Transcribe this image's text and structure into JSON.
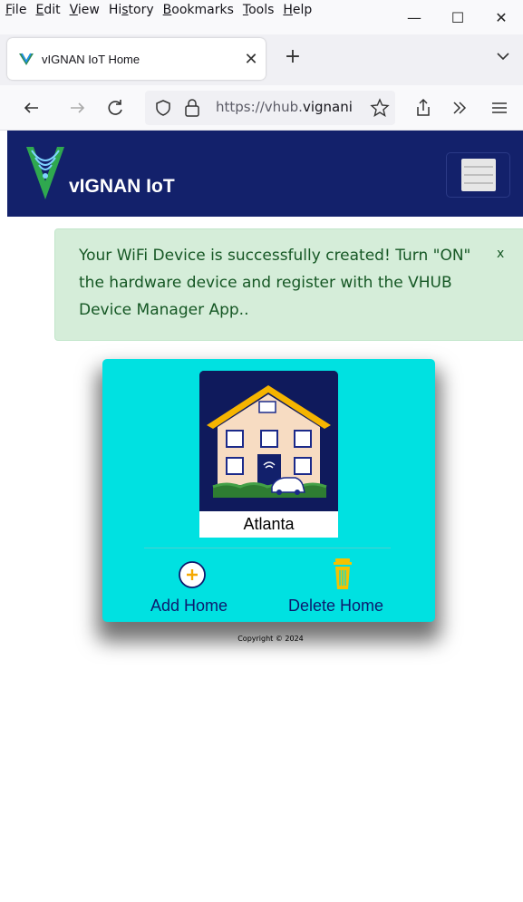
{
  "browser": {
    "menu": [
      "File",
      "Edit",
      "View",
      "History",
      "Bookmarks",
      "Tools",
      "Help"
    ],
    "menu_access_keys": [
      "F",
      "E",
      "V",
      "s",
      "B",
      "T",
      "H"
    ],
    "window_controls": {
      "minimize": "—",
      "maximize": "☐",
      "close": "✕"
    },
    "tab": {
      "title": "vIGNAN IoT Home",
      "close": "✕"
    },
    "new_tab": "+",
    "url": {
      "prefix": "https://vhub.",
      "highlight": "vignani"
    }
  },
  "site": {
    "name": "vIGNAN IoT",
    "header_color": "#13216b"
  },
  "alert": {
    "message": "Your WiFi Device is successfully created! Turn \"ON\" the hardware device and register with the VHUB Device Manager App..",
    "close": "x"
  },
  "card": {
    "background": "#00e1e1",
    "homes": [
      {
        "name": "Atlanta"
      }
    ],
    "add_label": "Add Home",
    "delete_label": "Delete Home"
  },
  "footer": {
    "copyright": "Copyright © 2024"
  }
}
